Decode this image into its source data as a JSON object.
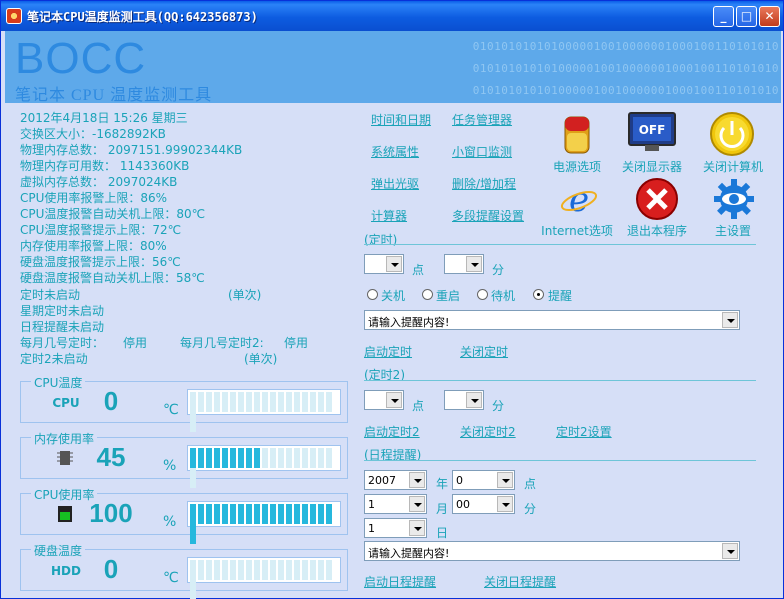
{
  "window": {
    "title": "笔记本CPU温度监测工具(QQ:642356873)",
    "buttons": {
      "minimize": "_",
      "maximize": "□",
      "close": "✕"
    }
  },
  "banner": {
    "logo": "BOCC",
    "subtitle": "笔记本 CPU 温度监测工具",
    "binary_lines": [
      "0101010101010000010010000001000100110101010",
      "0101010101010000010010000001000100110101010",
      "0101010101010000010010000001000100110101010"
    ]
  },
  "info": {
    "datetime": "2012年4月18日 15:26 星期三",
    "swap": "交换区大小：-1682892KB",
    "phys_total": "物理内存总数：  2097151.99902344KB",
    "phys_avail": "物理内存可用数：  1143360KB",
    "virt_total": "虚拟内存总数：  2097024KB",
    "cpu_usage_alarm": "CPU使用率报警上限：86%",
    "cpu_temp_shutdown": "CPU温度报警自动关机上限：80℃",
    "cpu_temp_warn": "CPU温度报警提示上限：72℃",
    "mem_usage_alarm": "内存使用率报警上限：80%",
    "hdd_temp_warn": "硬盘温度报警提示上限：56℃",
    "hdd_temp_shutdown": "硬盘温度报警自动关机上限：58℃",
    "timer_status": "定时未启动",
    "timer_once": "(单次)",
    "weekday_timer": "星期定时未启动",
    "schedule_status": "日程提醒未启动",
    "monthly1_label": "每月几号定时：",
    "monthly1_value": "停用",
    "monthly2_label": "每月几号定时2:",
    "monthly2_value": "停用",
    "timer2_status": "定时2未启动",
    "timer2_once": "(单次)"
  },
  "gauges": [
    {
      "legend": "CPU温度",
      "label": "CPU",
      "value": "0",
      "unit": "℃",
      "fill": 0,
      "icon": "cpu-label"
    },
    {
      "legend": "内存使用率",
      "label": "",
      "value": "45",
      "unit": "%",
      "fill": 0.45,
      "icon": "memory-chip-icon"
    },
    {
      "legend": "CPU使用率",
      "label": "",
      "value": "100",
      "unit": "%",
      "fill": 1.0,
      "icon": "cpu-usage-icon"
    },
    {
      "legend": "硬盘温度",
      "label": "HDD",
      "value": "0",
      "unit": "℃",
      "fill": 0,
      "icon": "hdd-label"
    }
  ],
  "links": {
    "datetime": "时间和日期",
    "task_manager": "任务管理器",
    "system_props": "系统属性",
    "mini_window": "小窗口监测",
    "eject": "弹出光驱",
    "add_remove": "删除/增加程",
    "calculator": "计算器",
    "multi_reminder": "多段提醒设置"
  },
  "icons": {
    "power": "电源选项",
    "monitor_off": "关闭显示器",
    "shutdown": "关闭计算机",
    "internet": "Internet选项",
    "exit": "退出本程序",
    "settings": "主设置",
    "monitor_text": "OFF"
  },
  "timer": {
    "section": "(定时)",
    "hour_unit": "点",
    "minute_unit": "分",
    "options": [
      "关机",
      "重启",
      "待机",
      "提醒"
    ],
    "selected": "提醒",
    "message_placeholder": "请输入提醒内容!",
    "start": "启动定时",
    "stop": "关闭定时"
  },
  "timer2": {
    "section": "(定时2)",
    "hour_unit": "点",
    "minute_unit": "分",
    "start": "启动定时2",
    "stop": "关闭定时2",
    "settings": "定时2设置"
  },
  "schedule": {
    "section": "(日程提醒)",
    "year": "2007",
    "year_unit": "年",
    "hour": "0",
    "hour_unit": "点",
    "month": "1",
    "month_unit": "月",
    "minute": "00",
    "minute_unit": "分",
    "day": "1",
    "day_unit": "日",
    "message_placeholder": "请输入提醒内容!",
    "start": "启动日程提醒",
    "stop": "关闭日程提醒"
  }
}
